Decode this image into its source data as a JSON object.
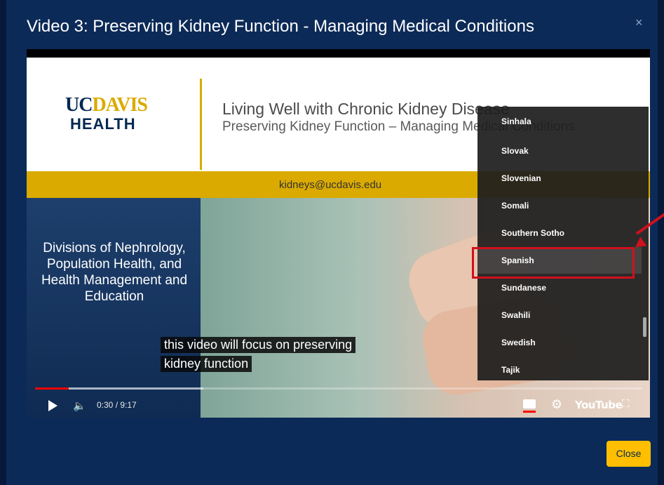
{
  "modal": {
    "title": "Video 3: Preserving Kidney Function - Managing Medical Conditions",
    "close_x": "×",
    "close_button_label": "Close",
    "accent_color": "#ffbf00"
  },
  "slide": {
    "logo_uc": "UC",
    "logo_davis": "DAVIS",
    "logo_health": "HEALTH",
    "heading": "Living Well with Chronic Kidney Disease",
    "subheading": "Preserving Kidney Function – Managing Medical Conditions",
    "email": "kidneys@ucdavis.edu",
    "left_text": "Divisions of Nephrology, Population Health, and Health Management and Education"
  },
  "captions": {
    "line1": "this video will focus on preserving",
    "line2": "kidney function"
  },
  "player": {
    "time": "0:30 / 9:17",
    "progress_fraction": 0.054,
    "youtube_label": "YouTube",
    "icons": [
      "play-icon",
      "volume-icon",
      "subtitles-icon",
      "gear-icon",
      "fullscreen-icon"
    ]
  },
  "subtitle_menu": {
    "items": [
      "Sinhala",
      "Slovak",
      "Slovenian",
      "Somali",
      "Southern Sotho",
      "Spanish",
      "Sundanese",
      "Swahili",
      "Swedish",
      "Tajik"
    ],
    "selected": "Spanish",
    "highlight_color": "#d0101d"
  }
}
